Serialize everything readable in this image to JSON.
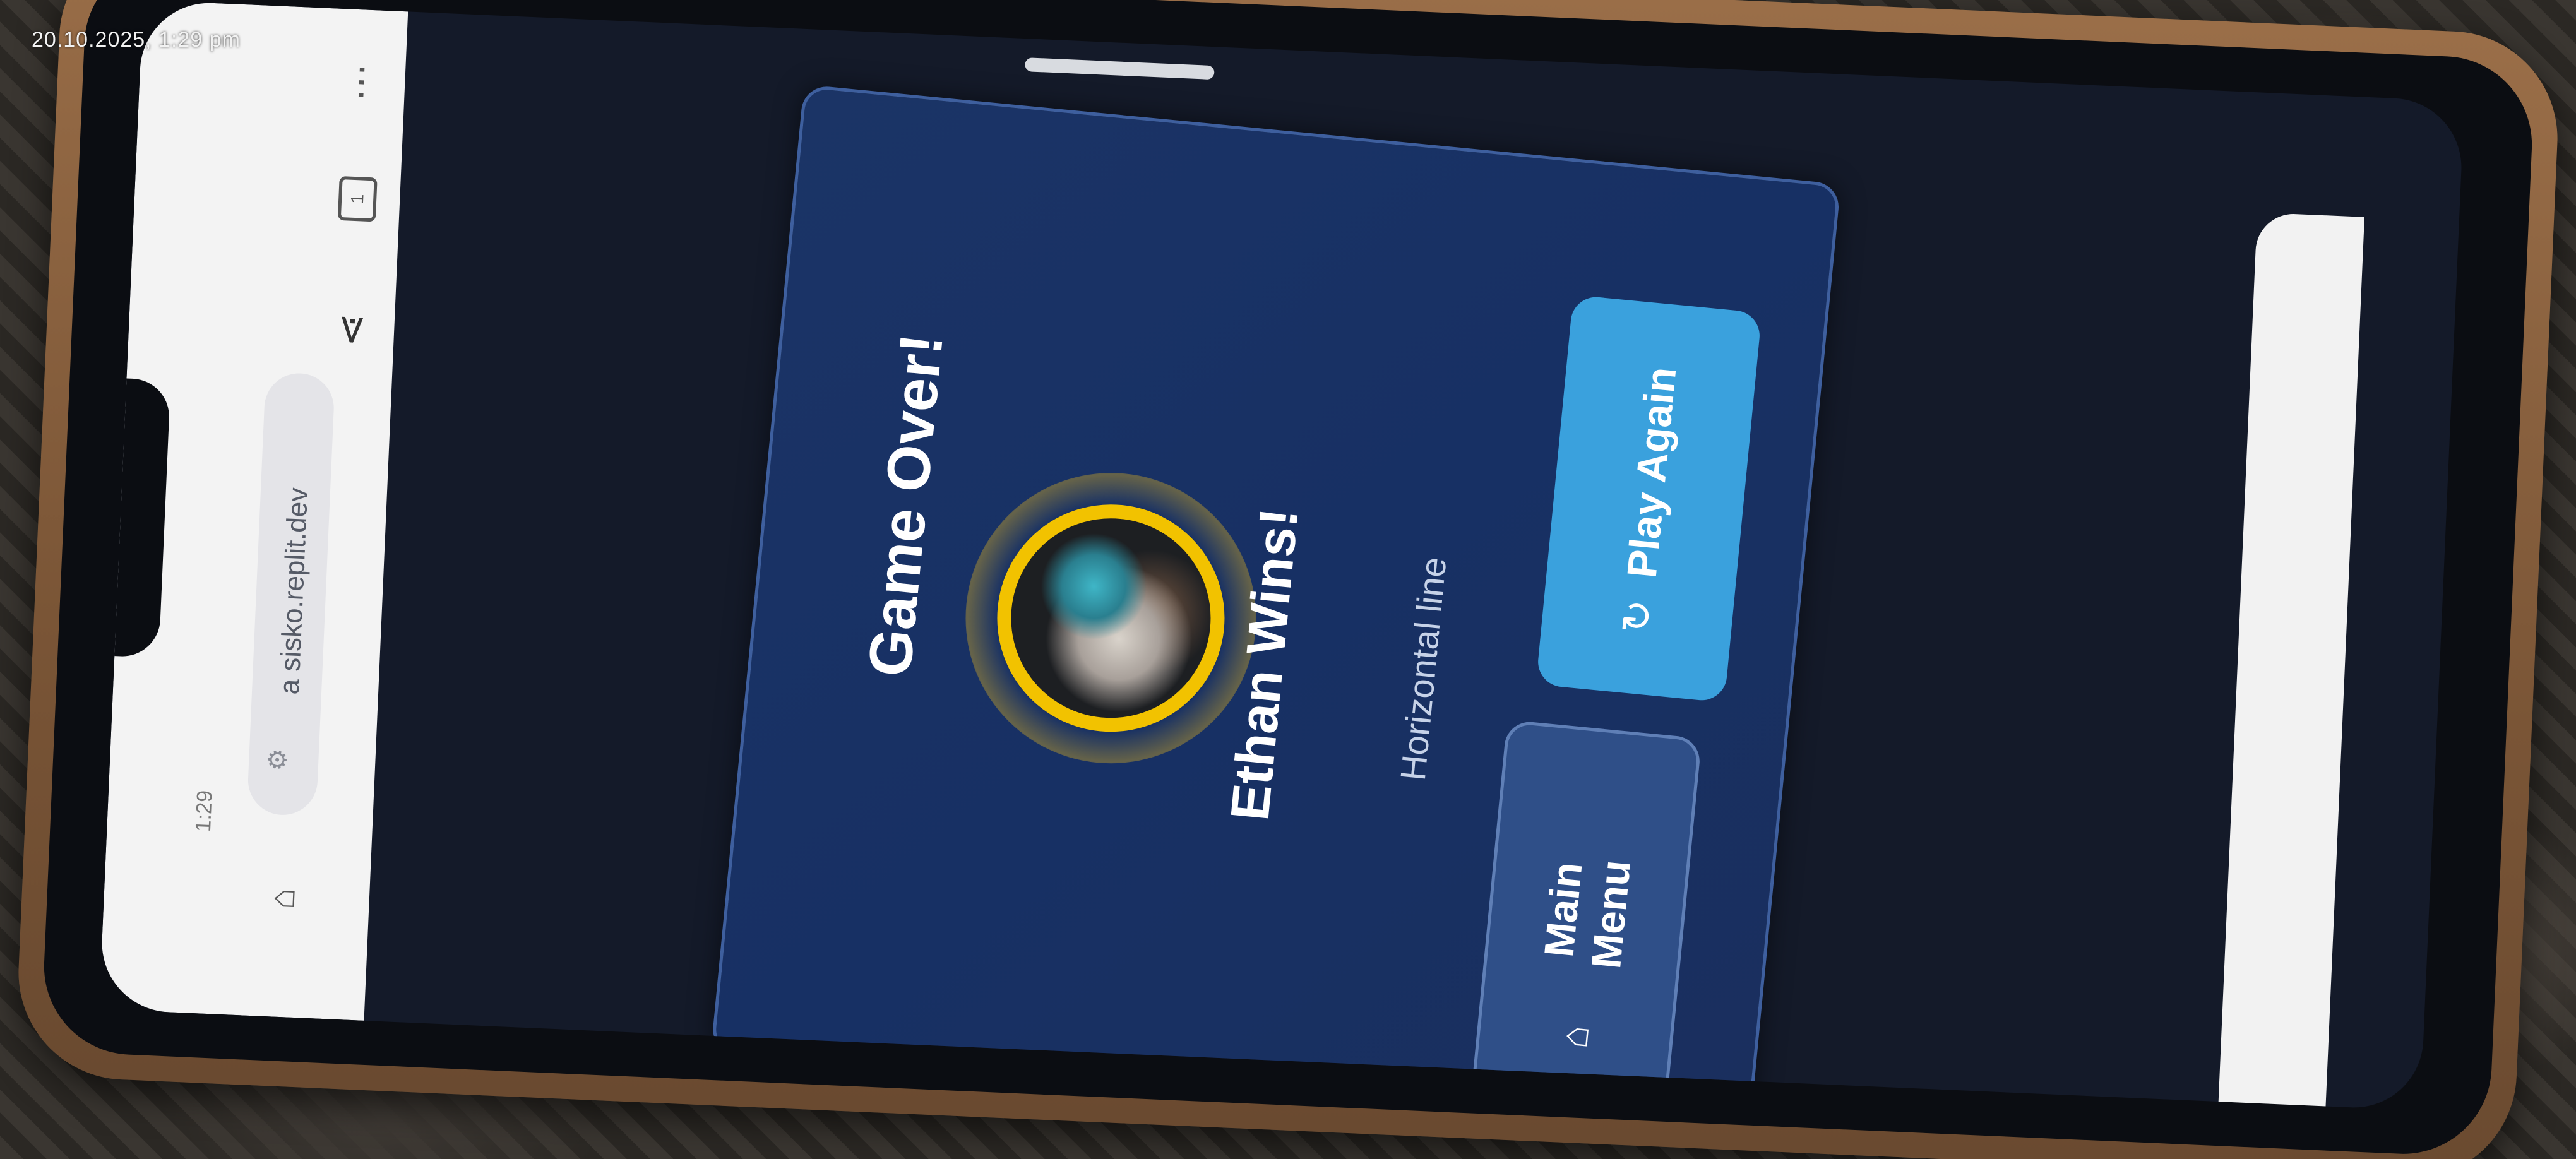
{
  "overlay": {
    "timestamp": "20.10.2025, 1:29 pm"
  },
  "browser": {
    "url": "a sisko.replit.dev",
    "status_time": "1:29",
    "icons": {
      "home": "home-icon",
      "share": "share-icon",
      "tabs": "tabs-icon",
      "more": "more-vertical-icon",
      "site_info": "site-info-icon"
    },
    "tab_count": "1"
  },
  "modal": {
    "title": "Game Over!",
    "winner": "Ethan Wins!",
    "detail": "Horizontal line",
    "play_again_label": "Play Again",
    "main_menu_label": "Main Menu",
    "avatar_border_color": "#f2c200",
    "play_again_color": "#3aa1dd",
    "main_menu_color": "#2f4f88"
  },
  "icons": {
    "replay": "replay-icon",
    "menu_home": "home-icon"
  }
}
